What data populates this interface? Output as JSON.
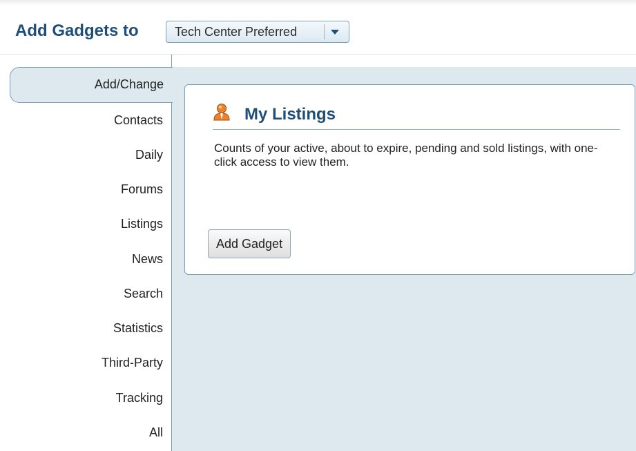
{
  "header": {
    "title": "Add Gadgets to",
    "dropdown_value": "Tech Center Preferred"
  },
  "sidebar": {
    "items": [
      {
        "label": "Add/Change",
        "active": true
      },
      {
        "label": "Contacts"
      },
      {
        "label": "Daily"
      },
      {
        "label": "Forums"
      },
      {
        "label": "Listings"
      },
      {
        "label": "News"
      },
      {
        "label": "Search"
      },
      {
        "label": "Statistics"
      },
      {
        "label": "Third-Party"
      },
      {
        "label": "Tracking"
      },
      {
        "label": "All"
      }
    ]
  },
  "gadget": {
    "icon": "person-icon",
    "title": "My Listings",
    "description": "Counts of your active, about to expire, pending and sold listings, with one-click access to view them.",
    "button_label": "Add Gadget"
  },
  "colors": {
    "accent": "#1f4e79",
    "panel": "#dde9ef",
    "border": "#7d9cb6",
    "icon": "#e8852a"
  }
}
